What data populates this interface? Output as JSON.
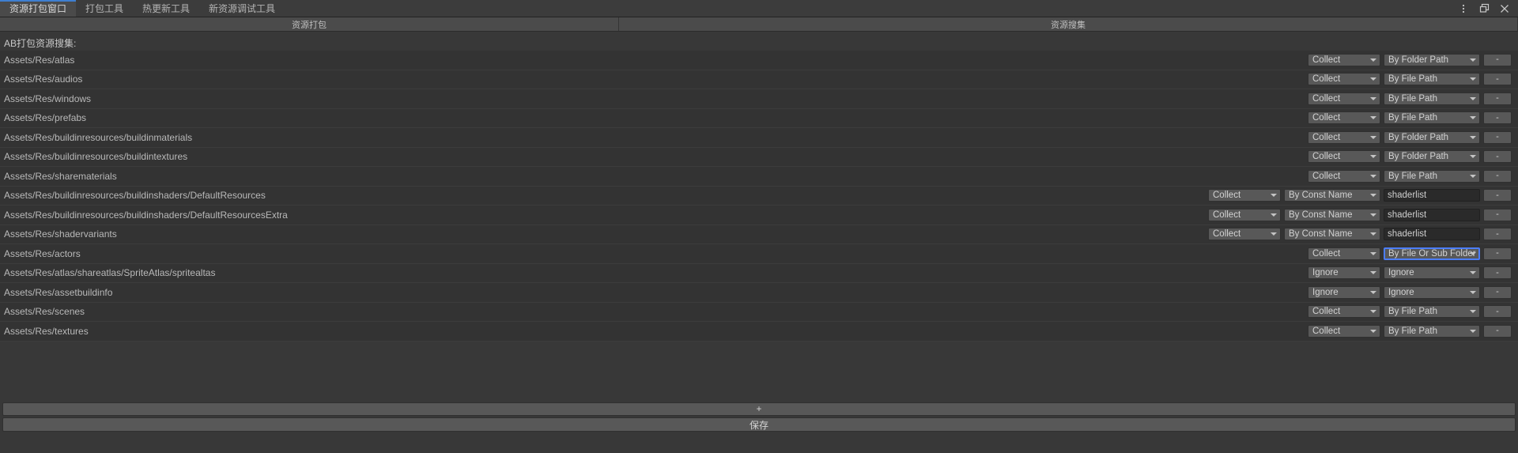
{
  "window": {
    "tabs": [
      {
        "label": "资源打包窗口",
        "active": true
      },
      {
        "label": "打包工具",
        "active": false
      },
      {
        "label": "热更新工具",
        "active": false
      },
      {
        "label": "新资源调试工具",
        "active": false
      }
    ],
    "controls": [
      {
        "name": "kebab-menu-icon",
        "glyph": "more"
      },
      {
        "name": "restore-window-icon",
        "glyph": "restore"
      },
      {
        "name": "close-window-icon",
        "glyph": "close"
      }
    ]
  },
  "section_bar": {
    "pack_label": "资源打包",
    "collect_label": "资源搜集"
  },
  "panel": {
    "title": "AB打包资源搜集:",
    "add_button_label": "+",
    "save_button_label": "保存"
  },
  "colors": {
    "accent": "#3f7fd1",
    "focus_outline": "#4c7eff",
    "row_bg": "#333333",
    "panel_bg": "#383838",
    "control_bg": "#585858",
    "field_bg": "#2a2a2a"
  },
  "table": {
    "remove_button_label": "-",
    "rows": [
      {
        "path": "Assets/Res/atlas",
        "mode": "Collect",
        "rule": "By Folder Path",
        "value": null,
        "focused": false
      },
      {
        "path": "Assets/Res/audios",
        "mode": "Collect",
        "rule": "By File Path",
        "value": null,
        "focused": false
      },
      {
        "path": "Assets/Res/windows",
        "mode": "Collect",
        "rule": "By File Path",
        "value": null,
        "focused": false
      },
      {
        "path": "Assets/Res/prefabs",
        "mode": "Collect",
        "rule": "By File Path",
        "value": null,
        "focused": false
      },
      {
        "path": "Assets/Res/buildinresources/buildinmaterials",
        "mode": "Collect",
        "rule": "By Folder Path",
        "value": null,
        "focused": false
      },
      {
        "path": "Assets/Res/buildinresources/buildintextures",
        "mode": "Collect",
        "rule": "By Folder Path",
        "value": null,
        "focused": false
      },
      {
        "path": "Assets/Res/sharematerials",
        "mode": "Collect",
        "rule": "By File Path",
        "value": null,
        "focused": false
      },
      {
        "path": "Assets/Res/buildinresources/buildinshaders/DefaultResources",
        "mode": "Collect",
        "rule": "By Const Name",
        "value": "shaderlist",
        "focused": false
      },
      {
        "path": "Assets/Res/buildinresources/buildinshaders/DefaultResourcesExtra",
        "mode": "Collect",
        "rule": "By Const Name",
        "value": "shaderlist",
        "focused": false
      },
      {
        "path": "Assets/Res/shadervariants",
        "mode": "Collect",
        "rule": "By Const Name",
        "value": "shaderlist",
        "focused": false
      },
      {
        "path": "Assets/Res/actors",
        "mode": "Collect",
        "rule": "By File Or Sub Folder",
        "value": null,
        "focused": true
      },
      {
        "path": "Assets/Res/atlas/shareatlas/SpriteAtlas/spritealtas",
        "mode": "Ignore",
        "rule": "Ignore",
        "value": null,
        "focused": false
      },
      {
        "path": "Assets/Res/assetbuildinfo",
        "mode": "Ignore",
        "rule": "Ignore",
        "value": null,
        "focused": false
      },
      {
        "path": "Assets/Res/scenes",
        "mode": "Collect",
        "rule": "By File Path",
        "value": null,
        "focused": false
      },
      {
        "path": "Assets/Res/textures",
        "mode": "Collect",
        "rule": "By File Path",
        "value": null,
        "focused": false
      }
    ]
  }
}
